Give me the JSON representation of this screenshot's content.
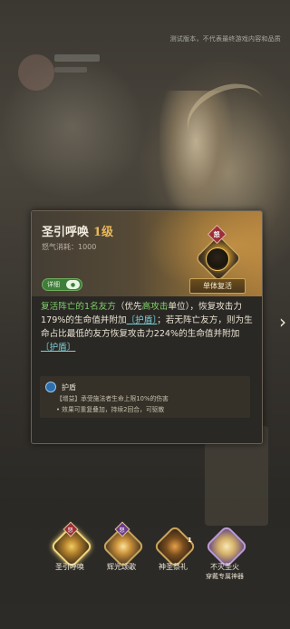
{
  "notice": "测试版本，不代表最终游戏内容和品质",
  "skill": {
    "name": "圣引呼唤",
    "level": "1级",
    "rage_cost": "怒气消耗：1000",
    "detail_label": "详细",
    "badge": "怒",
    "tag": "单体复活",
    "description": {
      "p1": "复活阵亡的1名友方",
      "p2": "（优先",
      "p3": "高攻击",
      "p4": "单位），恢复攻击力179%的生命值并附加",
      "p5": "〔护盾〕",
      "p6": "；若无阵亡友方，则为生命占比最低的友方恢复攻击力224%的生命值并附加",
      "p7": "〔护盾〕"
    },
    "buff": {
      "name": "护盾",
      "line1": "【增益】承受施法者生命上限10%的伤害",
      "line2": "• 效果可重复叠加，持续2回合，可驱散"
    }
  },
  "next_arrow": "›",
  "skill_bar": [
    {
      "label": "圣引呼唤",
      "sub": "",
      "badge": "怒",
      "count": "",
      "icon": "summon-icon",
      "selected": true
    },
    {
      "label": "辉光颂歌",
      "sub": "",
      "badge": "怒",
      "count": "",
      "icon": "radiance-icon",
      "selected": false
    },
    {
      "label": "神圣祭礼",
      "sub": "",
      "badge": "",
      "count": "1",
      "icon": "ritual-icon",
      "selected": false
    },
    {
      "label": "不灭圣火",
      "sub": "穿戴专属神器",
      "badge": "",
      "count": "",
      "icon": "holy-fire-icon",
      "selected": false
    }
  ],
  "colors": {
    "accent_gold": "#c9a35a",
    "highlight_green": "#7fd06a",
    "keyword_cyan": "#7bd0d9",
    "toggle_green": "#3e7d3a"
  }
}
